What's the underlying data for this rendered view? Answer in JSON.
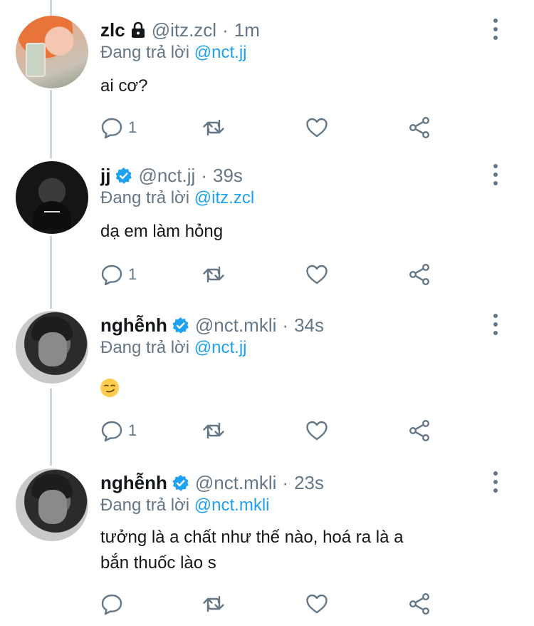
{
  "reply_prefix": "Đang trả lời",
  "tweets": [
    {
      "name": "zlc",
      "handle": "@itz.zcl",
      "separator": "·",
      "time": "1m",
      "reply_to": "@nct.jj",
      "text": [
        "ai cơ?"
      ],
      "reply_count": "1",
      "badge": "lock-icon"
    },
    {
      "name": "jj",
      "handle": "@nct.jj",
      "separator": "·",
      "time": "39s",
      "reply_to": "@itz.zcl",
      "text": [
        "dạ em làm hỏng"
      ],
      "reply_count": "1",
      "badge": "verified-icon"
    },
    {
      "name": "nghễnh",
      "handle": "@nct.mkli",
      "separator": "·",
      "time": "34s",
      "reply_to": "@nct.jj",
      "emoji": "smirking-face-emoji",
      "reply_count": "1",
      "badge": "verified-icon"
    },
    {
      "name": "nghễnh",
      "handle": "@nct.mkli",
      "separator": "·",
      "time": "23s",
      "reply_to": "@nct.mkli",
      "text": [
        "tưởng là a chất như thế nào, hoá ra là a",
        "bắn thuốc lào s"
      ],
      "reply_count": "",
      "badge": "verified-icon"
    }
  ],
  "colors": {
    "accent": "#1da1f2",
    "secondary_text": "#657786",
    "thread_line": "#ccd6dd"
  }
}
